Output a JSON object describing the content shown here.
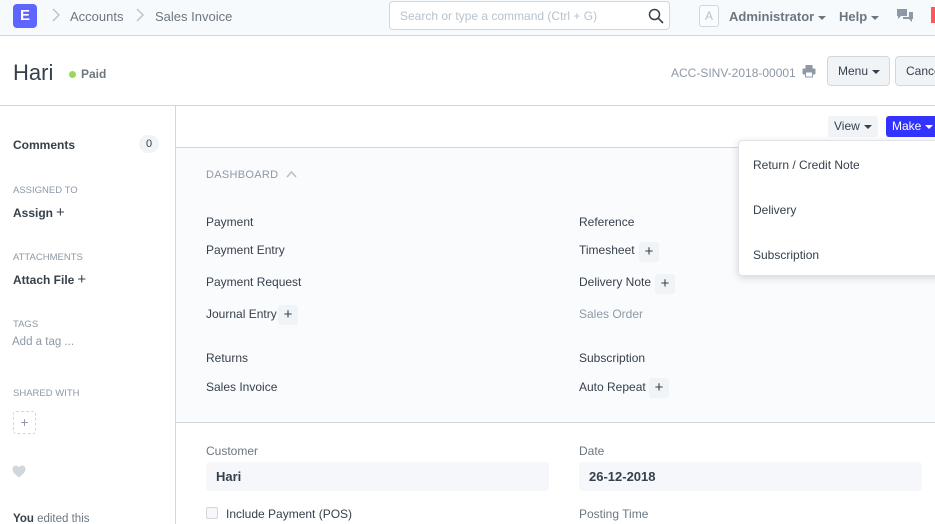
{
  "navbar": {
    "logo": "E",
    "breadcrumbs": [
      "Accounts",
      "Sales Invoice"
    ],
    "search_placeholder": "Search or type a command (Ctrl + G)",
    "avatar_letter": "A",
    "user": "Administrator",
    "help": "Help"
  },
  "page": {
    "title": "Hari",
    "status": "Paid",
    "doc_name": "ACC-SINV-2018-00001",
    "menu_label": "Menu",
    "cancel_label": "Cancel"
  },
  "sidebar": {
    "comments_label": "Comments",
    "comments_count": "0",
    "assigned_to_label": "ASSIGNED TO",
    "assign_label": "Assign",
    "attachments_label": "ATTACHMENTS",
    "attach_label": "Attach File",
    "tags_label": "TAGS",
    "add_tag": "Add a tag ...",
    "shared_with_label": "SHARED WITH",
    "edit_user": "You",
    "edit_text": "edited this"
  },
  "toolbar": {
    "view_label": "View",
    "make_label": "Make"
  },
  "dashboard": {
    "heading": "DASHBOARD",
    "left": {
      "group1": "Payment",
      "payment_entry": "Payment Entry",
      "payment_request": "Payment Request",
      "journal_entry": "Journal Entry",
      "group2": "Returns",
      "sales_invoice": "Sales Invoice"
    },
    "right": {
      "group1": "Reference",
      "timesheet": "Timesheet",
      "delivery_note": "Delivery Note",
      "sales_order": "Sales Order",
      "group2": "Subscription",
      "auto_repeat": "Auto Repeat"
    }
  },
  "form": {
    "customer_label": "Customer",
    "customer_value": "Hari",
    "date_label": "Date",
    "date_value": "26-12-2018",
    "include_payment_label": "Include Payment (POS)",
    "posting_time_label": "Posting Time"
  },
  "make_menu": {
    "items": [
      "Return / Credit Note",
      "Delivery",
      "Subscription"
    ]
  },
  "colors": {
    "brand": "#5e64ff",
    "make_button": "#3333ff",
    "paid_indicator": "#98d85b"
  }
}
